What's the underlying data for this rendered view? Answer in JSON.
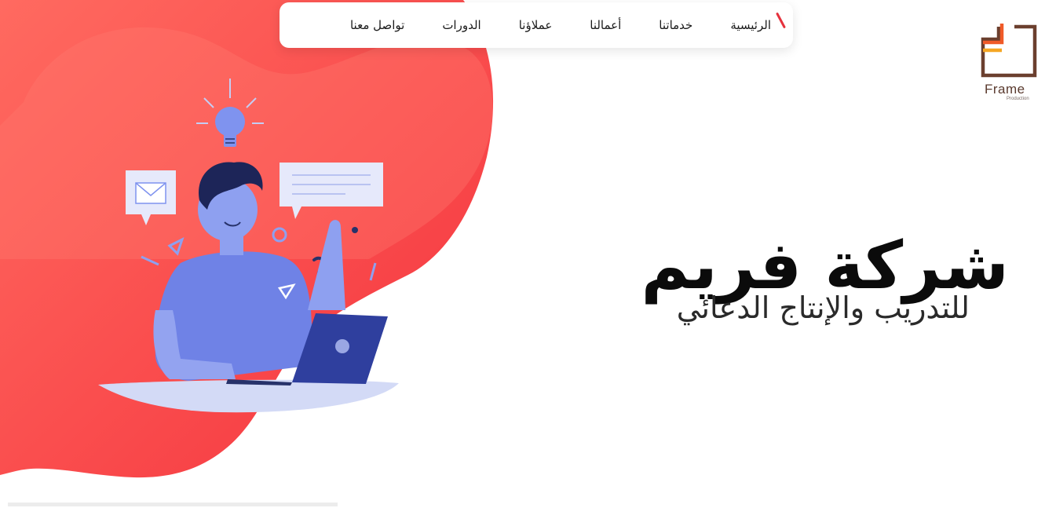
{
  "nav": {
    "items": [
      {
        "label": "الرئيسية",
        "active": true
      },
      {
        "label": "خدماتنا",
        "active": false
      },
      {
        "label": "أعمالنا",
        "active": false
      },
      {
        "label": "عملاؤنا",
        "active": false
      },
      {
        "label": "الدورات",
        "active": false
      },
      {
        "label": "تواصل معنا",
        "active": false
      }
    ]
  },
  "logo": {
    "name": "Frame",
    "sub": "Production"
  },
  "hero": {
    "title": "شركة فريم",
    "subtitle": "للتدريب والإنتاج الدعائي"
  },
  "colors": {
    "accent": "#f03e47",
    "blob": "#fb4c52",
    "illustration": "#7c8de8"
  },
  "icons": [
    "lightbulb-icon",
    "envelope-icon",
    "chat-bubble-icon",
    "laptop-icon"
  ]
}
